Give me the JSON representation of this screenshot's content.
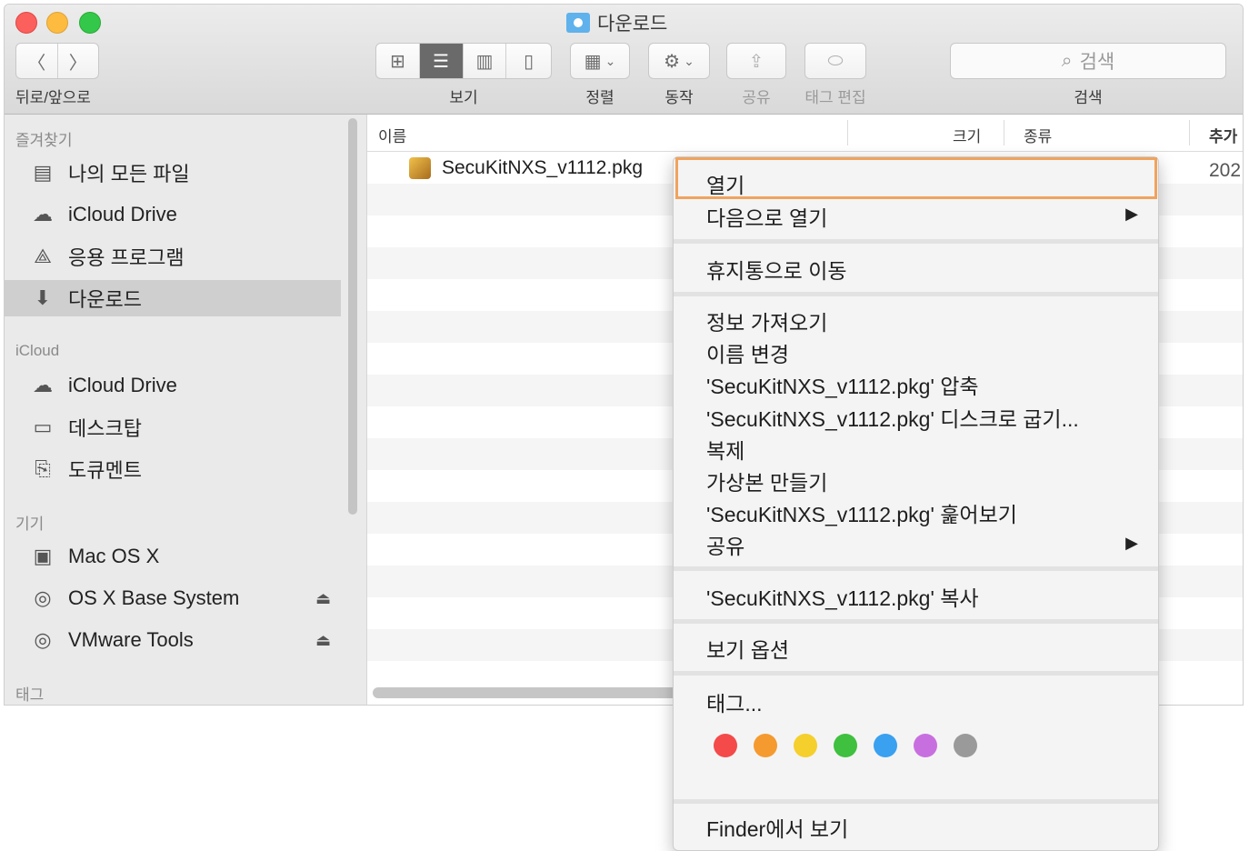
{
  "window": {
    "title": "다운로드"
  },
  "toolbar": {
    "nav_label": "뒤로/앞으로",
    "view_label": "보기",
    "sort_label": "정렬",
    "action_label": "동작",
    "share_label": "공유",
    "tag_edit_label": "태그 편집",
    "search_label": "검색",
    "search_placeholder": "검색"
  },
  "sidebar": {
    "favorites_header": "즐겨찾기",
    "favorites": [
      {
        "label": "나의 모든 파일",
        "icon": "all-files-icon"
      },
      {
        "label": "iCloud Drive",
        "icon": "cloud-icon"
      },
      {
        "label": "응용 프로그램",
        "icon": "applications-icon"
      },
      {
        "label": "다운로드",
        "icon": "download-icon",
        "selected": true
      }
    ],
    "icloud_header": "iCloud",
    "icloud": [
      {
        "label": "iCloud Drive",
        "icon": "cloud-icon"
      },
      {
        "label": "데스크탑",
        "icon": "desktop-icon"
      },
      {
        "label": "도큐멘트",
        "icon": "document-icon"
      }
    ],
    "devices_header": "기기",
    "devices": [
      {
        "label": "Mac OS X",
        "icon": "disk-icon"
      },
      {
        "label": "OS X Base System",
        "icon": "optical-disk-icon",
        "ejectable": true
      },
      {
        "label": "VMware Tools",
        "icon": "optical-disk-icon",
        "ejectable": true
      }
    ],
    "tags_header": "태그"
  },
  "list": {
    "columns": [
      "이름",
      "크기",
      "종류",
      "추가"
    ],
    "file_name": "SecuKitNXS_v1112.pkg",
    "file_added": "202"
  },
  "context_menu": {
    "items": [
      "열기",
      "다음으로 열기",
      "휴지통으로 이동",
      "정보 가져오기",
      "이름 변경",
      "'SecuKitNXS_v1112.pkg' 압축",
      "'SecuKitNXS_v1112.pkg' 디스크로 굽기...",
      "복제",
      "가상본 만들기",
      "'SecuKitNXS_v1112.pkg' 훑어보기",
      "공유",
      "'SecuKitNXS_v1112.pkg' 복사",
      "보기 옵션",
      "태그...",
      "Finder에서 보기"
    ],
    "tag_colors": [
      "#f44a4a",
      "#f59a2f",
      "#f5cf2c",
      "#3fc03f",
      "#3aa0f0",
      "#c86fe0",
      "#9a9a9a"
    ],
    "highlight_color": "#f0a35e"
  }
}
